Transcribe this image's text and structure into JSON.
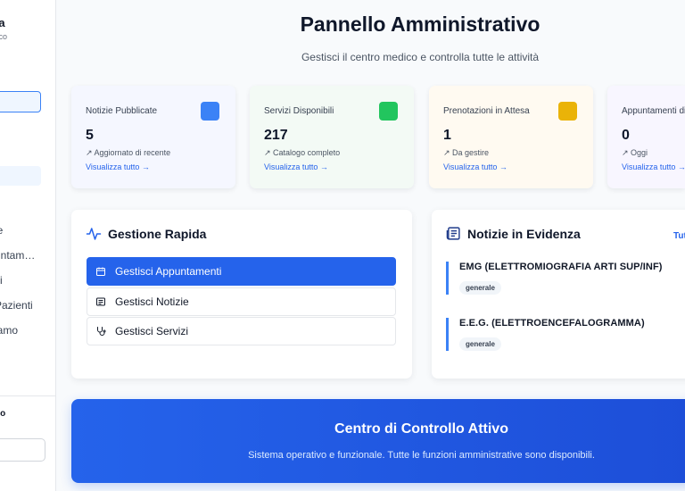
{
  "sidebar": {
    "brand": "ta",
    "brand_sub": "tico",
    "items": [
      "ie",
      "untam…",
      "zi",
      "Pazienti",
      "iamo"
    ],
    "footer_label": "ito"
  },
  "header": {
    "title": "Pannello Amministrativo",
    "subtitle": "Gestisci il centro medico e controlla tutte le attività"
  },
  "stats": [
    {
      "label": "Notizie Pubblicate",
      "value": "5",
      "note": "↗ Aggiornato di recente",
      "link": "Visualizza tutto →",
      "color": "#3b82f6",
      "bg": "#f5f7ff"
    },
    {
      "label": "Servizi Disponibili",
      "value": "217",
      "note": "↗ Catalogo completo",
      "link": "Visualizza tutto →",
      "color": "#22c55e",
      "bg": "#f3faf5"
    },
    {
      "label": "Prenotazioni in Attesa",
      "value": "1",
      "note": "↗ Da gestire",
      "link": "Visualizza tutto →",
      "color": "#eab308",
      "bg": "#fffaf1"
    },
    {
      "label": "Appuntamenti di",
      "value": "0",
      "note": "↗ Oggi",
      "link": "Visualizza tutto →",
      "color": "#8b5cf6",
      "bg": "#f8f6ff"
    }
  ],
  "quick": {
    "title": "Gestione Rapida",
    "buttons": [
      "Gestisci Appuntamenti",
      "Gestisci Notizie",
      "Gestisci Servizi"
    ]
  },
  "featured": {
    "title": "Notizie in Evidenza",
    "all_link": "Tut",
    "items": [
      {
        "title": "EMG (ELETTROMIOGRAFIA ARTI SUP/INF)",
        "tag": "generale"
      },
      {
        "title": "E.E.G. (ELETTROENCEFALOGRAMMA)",
        "tag": "generale"
      }
    ]
  },
  "banner": {
    "title": "Centro di Controllo Attivo",
    "text": "Sistema operativo e funzionale. Tutte le funzioni amministrative sono disponibili."
  }
}
